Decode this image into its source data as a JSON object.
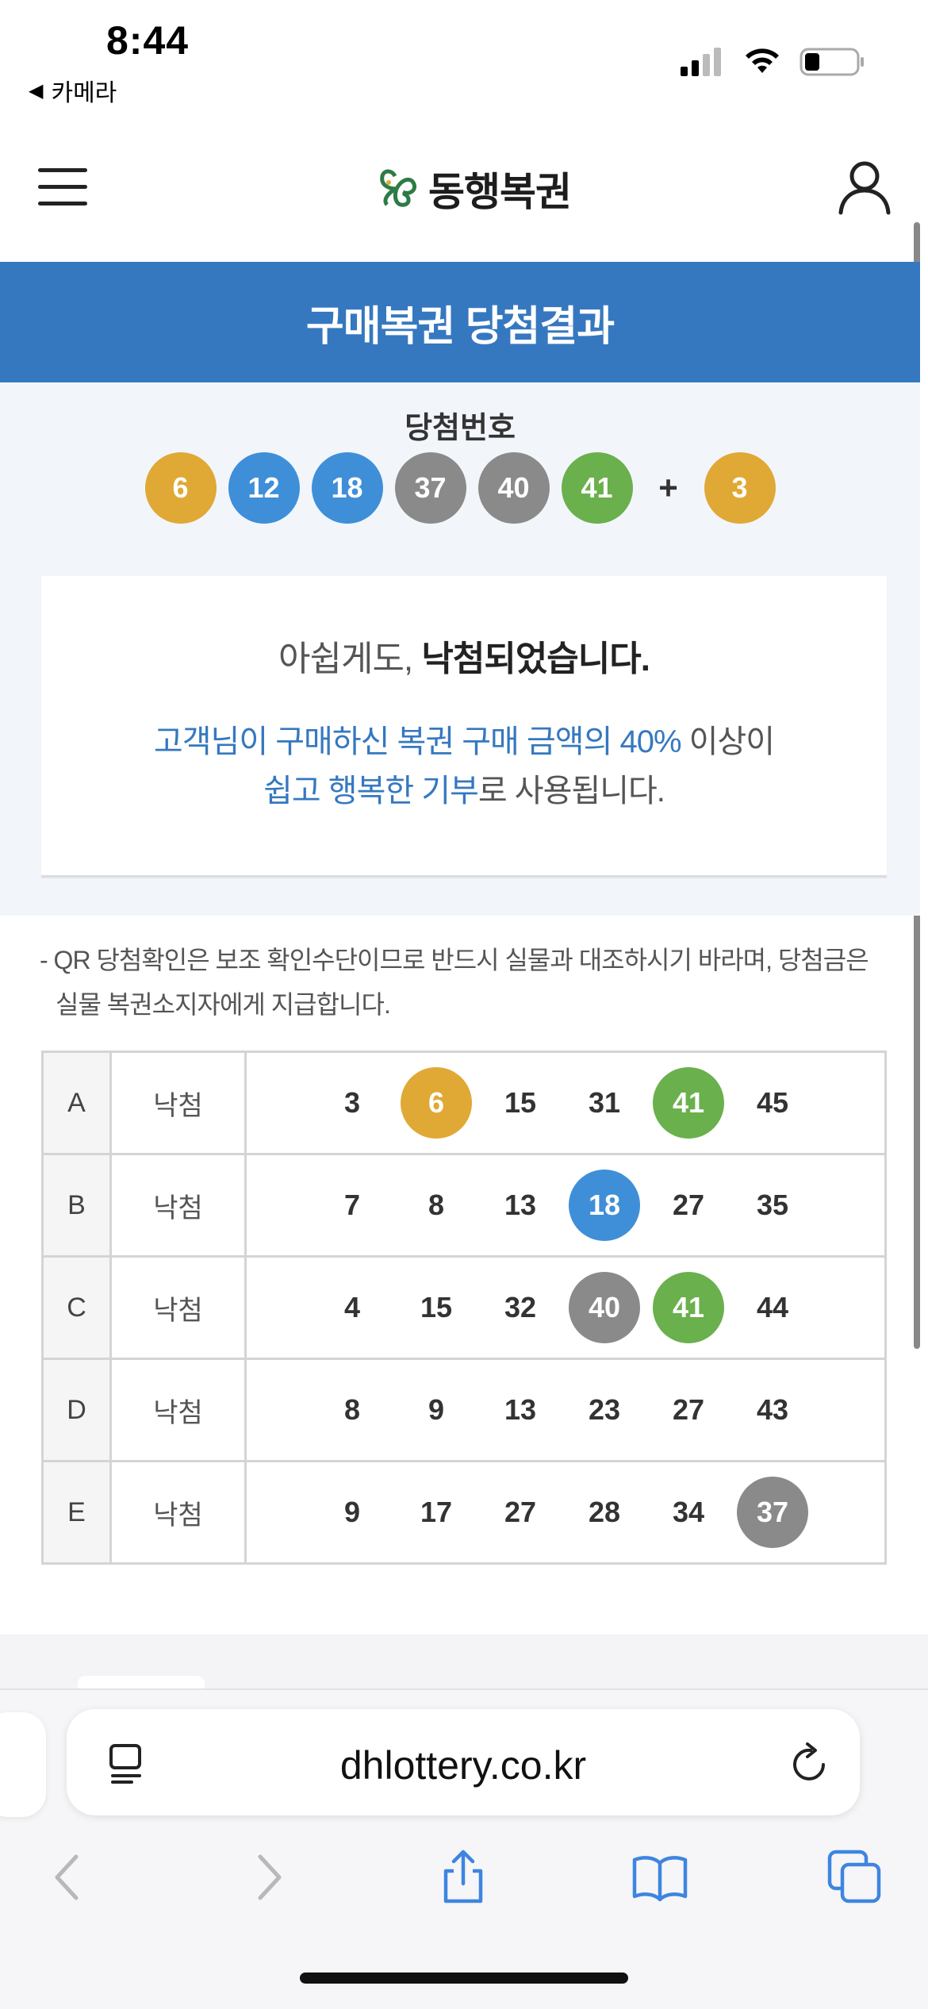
{
  "status_bar": {
    "time": "8:44",
    "back_app": "카메라",
    "back_icon": "◀"
  },
  "header": {
    "logo_text": "동행복권"
  },
  "title": "구매복권 당첨결과",
  "winning": {
    "label": "당첨번호",
    "numbers": [
      {
        "value": "6",
        "color": "#e0a935"
      },
      {
        "value": "12",
        "color": "#3f8fd8"
      },
      {
        "value": "18",
        "color": "#3f8fd8"
      },
      {
        "value": "37",
        "color": "#8a8a8a"
      },
      {
        "value": "40",
        "color": "#8a8a8a"
      },
      {
        "value": "41",
        "color": "#6ab04c"
      }
    ],
    "plus": "+",
    "bonus": {
      "value": "3",
      "color": "#e0a935"
    }
  },
  "result": {
    "prefix": "아쉽게도, ",
    "bold": "낙첨되었습니다.",
    "donation_hl1": "고객님이 구매하신 복권 구매 금액의 40%",
    "donation_rest1": " 이상이",
    "donation_hl2": "쉽고 행복한 기부",
    "donation_rest2": "로 사용됩니다."
  },
  "notice": "- QR 당첨확인은 보조 확인수단이므로 반드시 실물과 대조하시기 바라며, 당첨금은 실물 복권소지자에게 지급합니다.",
  "tickets": [
    {
      "line": "A",
      "status": "낙첨",
      "numbers": [
        {
          "v": "3",
          "hit": false,
          "color": ""
        },
        {
          "v": "6",
          "hit": true,
          "color": "#e0a935"
        },
        {
          "v": "15",
          "hit": false,
          "color": ""
        },
        {
          "v": "31",
          "hit": false,
          "color": ""
        },
        {
          "v": "41",
          "hit": true,
          "color": "#6ab04c"
        },
        {
          "v": "45",
          "hit": false,
          "color": ""
        }
      ]
    },
    {
      "line": "B",
      "status": "낙첨",
      "numbers": [
        {
          "v": "7",
          "hit": false,
          "color": ""
        },
        {
          "v": "8",
          "hit": false,
          "color": ""
        },
        {
          "v": "13",
          "hit": false,
          "color": ""
        },
        {
          "v": "18",
          "hit": true,
          "color": "#3f8fd8"
        },
        {
          "v": "27",
          "hit": false,
          "color": ""
        },
        {
          "v": "35",
          "hit": false,
          "color": ""
        }
      ]
    },
    {
      "line": "C",
      "status": "낙첨",
      "numbers": [
        {
          "v": "4",
          "hit": false,
          "color": ""
        },
        {
          "v": "15",
          "hit": false,
          "color": ""
        },
        {
          "v": "32",
          "hit": false,
          "color": ""
        },
        {
          "v": "40",
          "hit": true,
          "color": "#8a8a8a"
        },
        {
          "v": "41",
          "hit": true,
          "color": "#6ab04c"
        },
        {
          "v": "44",
          "hit": false,
          "color": ""
        }
      ]
    },
    {
      "line": "D",
      "status": "낙첨",
      "numbers": [
        {
          "v": "8",
          "hit": false,
          "color": ""
        },
        {
          "v": "9",
          "hit": false,
          "color": ""
        },
        {
          "v": "13",
          "hit": false,
          "color": ""
        },
        {
          "v": "23",
          "hit": false,
          "color": ""
        },
        {
          "v": "27",
          "hit": false,
          "color": ""
        },
        {
          "v": "43",
          "hit": false,
          "color": ""
        }
      ]
    },
    {
      "line": "E",
      "status": "낙첨",
      "numbers": [
        {
          "v": "9",
          "hit": false,
          "color": ""
        },
        {
          "v": "17",
          "hit": false,
          "color": ""
        },
        {
          "v": "27",
          "hit": false,
          "color": ""
        },
        {
          "v": "28",
          "hit": false,
          "color": ""
        },
        {
          "v": "34",
          "hit": false,
          "color": ""
        },
        {
          "v": "37",
          "hit": true,
          "color": "#8a8a8a"
        }
      ]
    }
  ],
  "browser": {
    "url": "dhlottery.co.kr",
    "icons": [
      "reader-icon",
      "reload-icon",
      "back-arrow-icon",
      "forward-arrow-icon",
      "share-icon",
      "bookmarks-icon",
      "tabs-icon"
    ]
  },
  "colors": {
    "brand_blue": "#3578c0",
    "yellow": "#e0a935",
    "blue": "#3f8fd8",
    "grey": "#8a8a8a",
    "green": "#6ab04c"
  }
}
